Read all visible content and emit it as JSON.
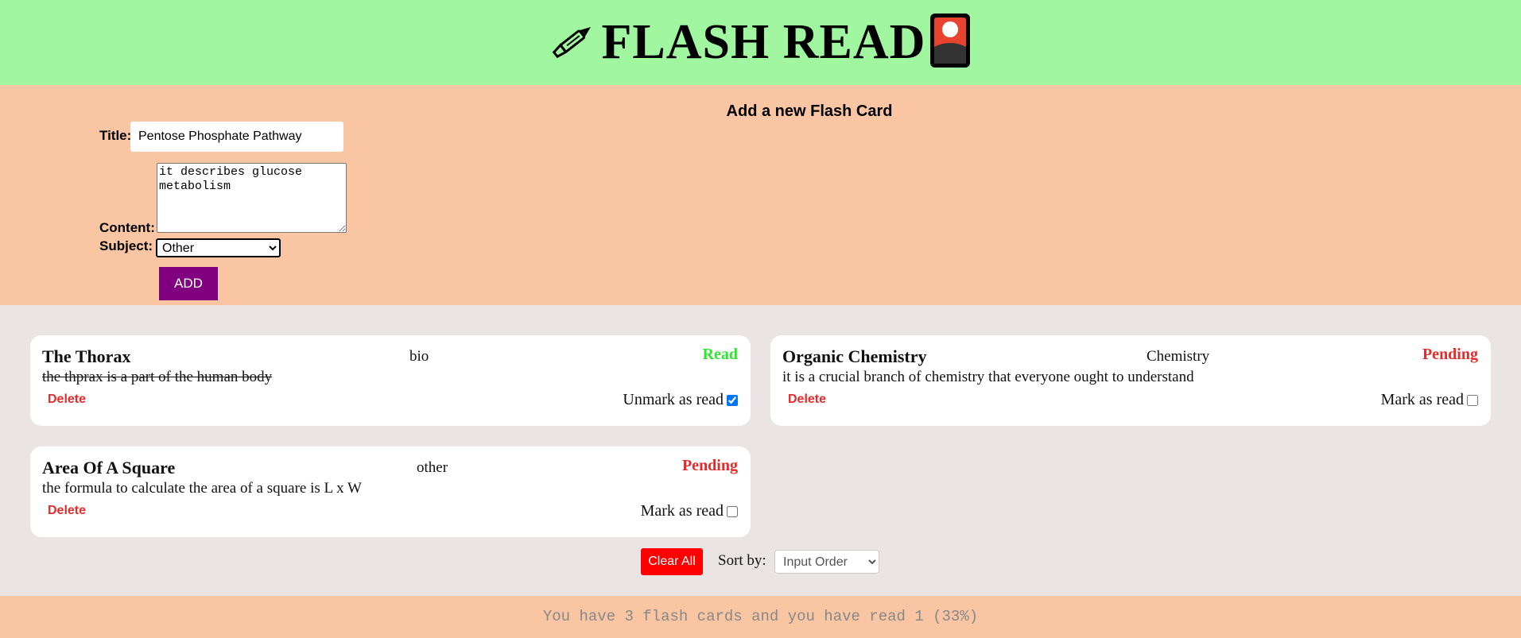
{
  "header": {
    "title": "FLASH READ",
    "left_icon": "fountain-pen-icon",
    "right_icon": "flash-card-icon"
  },
  "form": {
    "heading": "Add a new Flash Card",
    "title_label": "Title:",
    "title_value": "Pentose Phosphate Pathway",
    "content_label": "Content:",
    "content_value": "it describes glucose metabolism",
    "subject_label": "Subject:",
    "subject_value": "Other",
    "add_label": "ADD"
  },
  "cards": [
    {
      "title": "The Thorax",
      "subject": "bio",
      "status": "Read",
      "content": "the thprax is a part of the human body",
      "delete_label": "Delete",
      "mark_label": "Unmark as read",
      "checked": true
    },
    {
      "title": "Organic Chemistry",
      "subject": "Chemistry",
      "status": "Pending",
      "content": "it is a crucial branch of chemistry that everyone ought to understand",
      "delete_label": "Delete",
      "mark_label": "Mark as read",
      "checked": false
    },
    {
      "title": "Area Of A Square",
      "subject": "other",
      "status": "Pending",
      "content": "the formula to calculate the area of a square is L x W",
      "delete_label": "Delete",
      "mark_label": "Mark as read",
      "checked": false
    }
  ],
  "controls": {
    "clear_label": "Clear All",
    "sort_label": "Sort by:",
    "sort_value": "Input Order"
  },
  "footer": {
    "stats": "You have 3 flash cards and you have read 1 (33%)"
  },
  "colors": {
    "header_bg": "#a0f7a0",
    "form_bg": "#f9c5a2",
    "add_button": "#800080",
    "clear_button": "#ff0000",
    "status_read": "#2ee62e",
    "status_pending": "#e52b2b"
  }
}
